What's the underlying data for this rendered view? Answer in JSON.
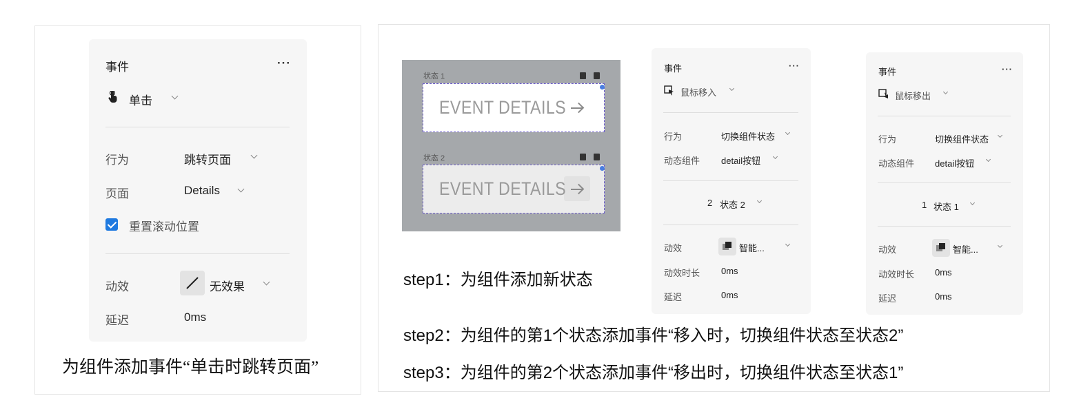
{
  "panel1": {
    "title": "事件",
    "more": "···",
    "trigger": "单击",
    "action_label": "行为",
    "action_value": "跳转页面",
    "page_label": "页面",
    "page_value": "Details",
    "checkbox_label": "重置滚动位置",
    "checkbox_checked": true,
    "effect_label": "动效",
    "effect_value": "无效果",
    "delay_label": "延迟",
    "delay_value": "0ms",
    "caption": "为组件添加事件“单击时跳转页面”"
  },
  "canvas": {
    "state1_label": "状态 1",
    "state2_label": "状态 2",
    "button_text": "EVENT DETAILS"
  },
  "panel2": {
    "title": "事件",
    "more": "···",
    "trigger": "鼠标移入",
    "action_label": "行为",
    "action_value": "切换组件状态",
    "component_label": "动态组件",
    "component_value": "detail按钮",
    "state_num": "2",
    "state_value": "状态 2",
    "effect_label": "动效",
    "effect_value": "智能...",
    "duration_label": "动效时长",
    "duration_value": "0ms",
    "delay_label": "延迟",
    "delay_value": "0ms"
  },
  "panel3": {
    "title": "事件",
    "more": "···",
    "trigger": "鼠标移出",
    "action_label": "行为",
    "action_value": "切换组件状态",
    "component_label": "动态组件",
    "component_value": "detail按钮",
    "state_num": "1",
    "state_value": "状态 1",
    "effect_label": "动效",
    "effect_value": "智能...",
    "duration_label": "动效时长",
    "duration_value": "0ms",
    "delay_label": "延迟",
    "delay_value": "0ms"
  },
  "steps": {
    "step1": "step1：为组件添加新状态",
    "step2": "step2：为组件的第1个状态添加事件“移入时，切换组件状态至状态2”",
    "step3": "step3：为组件的第2个状态添加事件“移出时，切换组件状态至状态1”"
  }
}
